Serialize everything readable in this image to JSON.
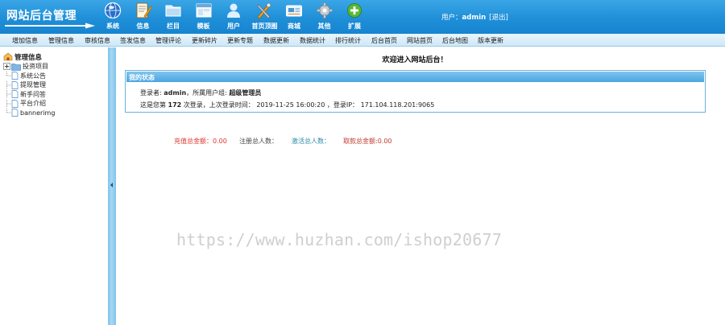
{
  "header": {
    "logo_text": "网站后台管理",
    "nav": [
      {
        "label": "系统",
        "icon": "globe-icon"
      },
      {
        "label": "信息",
        "icon": "document-edit-icon"
      },
      {
        "label": "栏目",
        "icon": "folder-icon"
      },
      {
        "label": "模板",
        "icon": "window-icon"
      },
      {
        "label": "用户",
        "icon": "user-icon"
      },
      {
        "label": "首页顶图",
        "icon": "tools-icon"
      },
      {
        "label": "商城",
        "icon": "card-icon"
      },
      {
        "label": "其他",
        "icon": "gear-icon"
      },
      {
        "label": "扩展",
        "icon": "add-icon"
      }
    ],
    "user_prefix": "用户：",
    "username": "admin",
    "logout": "[退出]"
  },
  "submenu": [
    "增加信息",
    "管理信息",
    "审核信息",
    "签发信息",
    "管理评论",
    "更新碎片",
    "更新专题",
    "数据更新",
    "数据统计",
    "排行统计",
    "后台首页",
    "网站首页",
    "后台地图",
    "版本更新"
  ],
  "tree": {
    "root": "管理信息",
    "folder": "投资项目",
    "items": [
      "系统公告",
      "提现管理",
      "新手问答",
      "平台介绍",
      "bannerimg"
    ]
  },
  "main": {
    "welcome": "欢迎进入网站后台！",
    "panel_title": "我的状态",
    "login_label": "登录者: ",
    "login_user": "admin",
    "group_label": "，所属用户组: ",
    "group_value": "超级管理员",
    "count_prefix": "这是您第 ",
    "count_value": "172",
    "count_suffix": " 次登录，上次登录时间： 2019-11-25 16:00:20 ，登录IP： 171.104.118.201:9065",
    "stats": {
      "recharge": "充值总金额：0.00",
      "registered": "注册总人数：",
      "activated": "激活总人数：",
      "withdraw": "取款总金额:0.00"
    }
  },
  "watermark": "https://www.huzhan.com/ishop20677",
  "colors": {
    "header": "#1f8fd8",
    "splitter": "#7ec3ec",
    "panel_border": "#6ab2de",
    "recharge": "#e0342b"
  }
}
